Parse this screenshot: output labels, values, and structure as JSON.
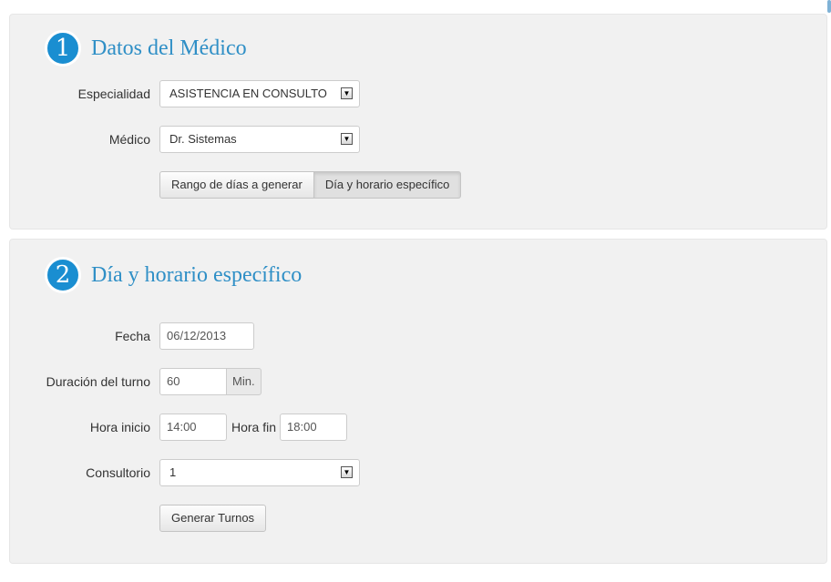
{
  "section1": {
    "number": "1",
    "title": "Datos del Médico",
    "especialidad": {
      "label": "Especialidad",
      "value": "ASISTENCIA EN CONSULTO"
    },
    "medico": {
      "label": "Médico",
      "value": "Dr. Sistemas"
    },
    "toggle": {
      "option1": "Rango de días a generar",
      "option2": "Día y horario específico",
      "active": "option2"
    }
  },
  "section2": {
    "number": "2",
    "title": "Día y horario específico",
    "fecha": {
      "label": "Fecha",
      "value": "06/12/2013"
    },
    "duracion": {
      "label": "Duración del turno",
      "value": "60",
      "unit": "Min."
    },
    "hora_inicio": {
      "label": "Hora inicio",
      "value": "14:00"
    },
    "hora_fin": {
      "label": "Hora fin",
      "value": "18:00"
    },
    "consultorio": {
      "label": "Consultorio",
      "value": "1"
    },
    "submit_label": "Generar Turnos"
  },
  "icons": {
    "dropdown": "dropdown-arrow-icon"
  },
  "colors": {
    "accent": "#2f8fc6",
    "badge": "#1a8ed1",
    "panel": "#f1f1f1"
  }
}
